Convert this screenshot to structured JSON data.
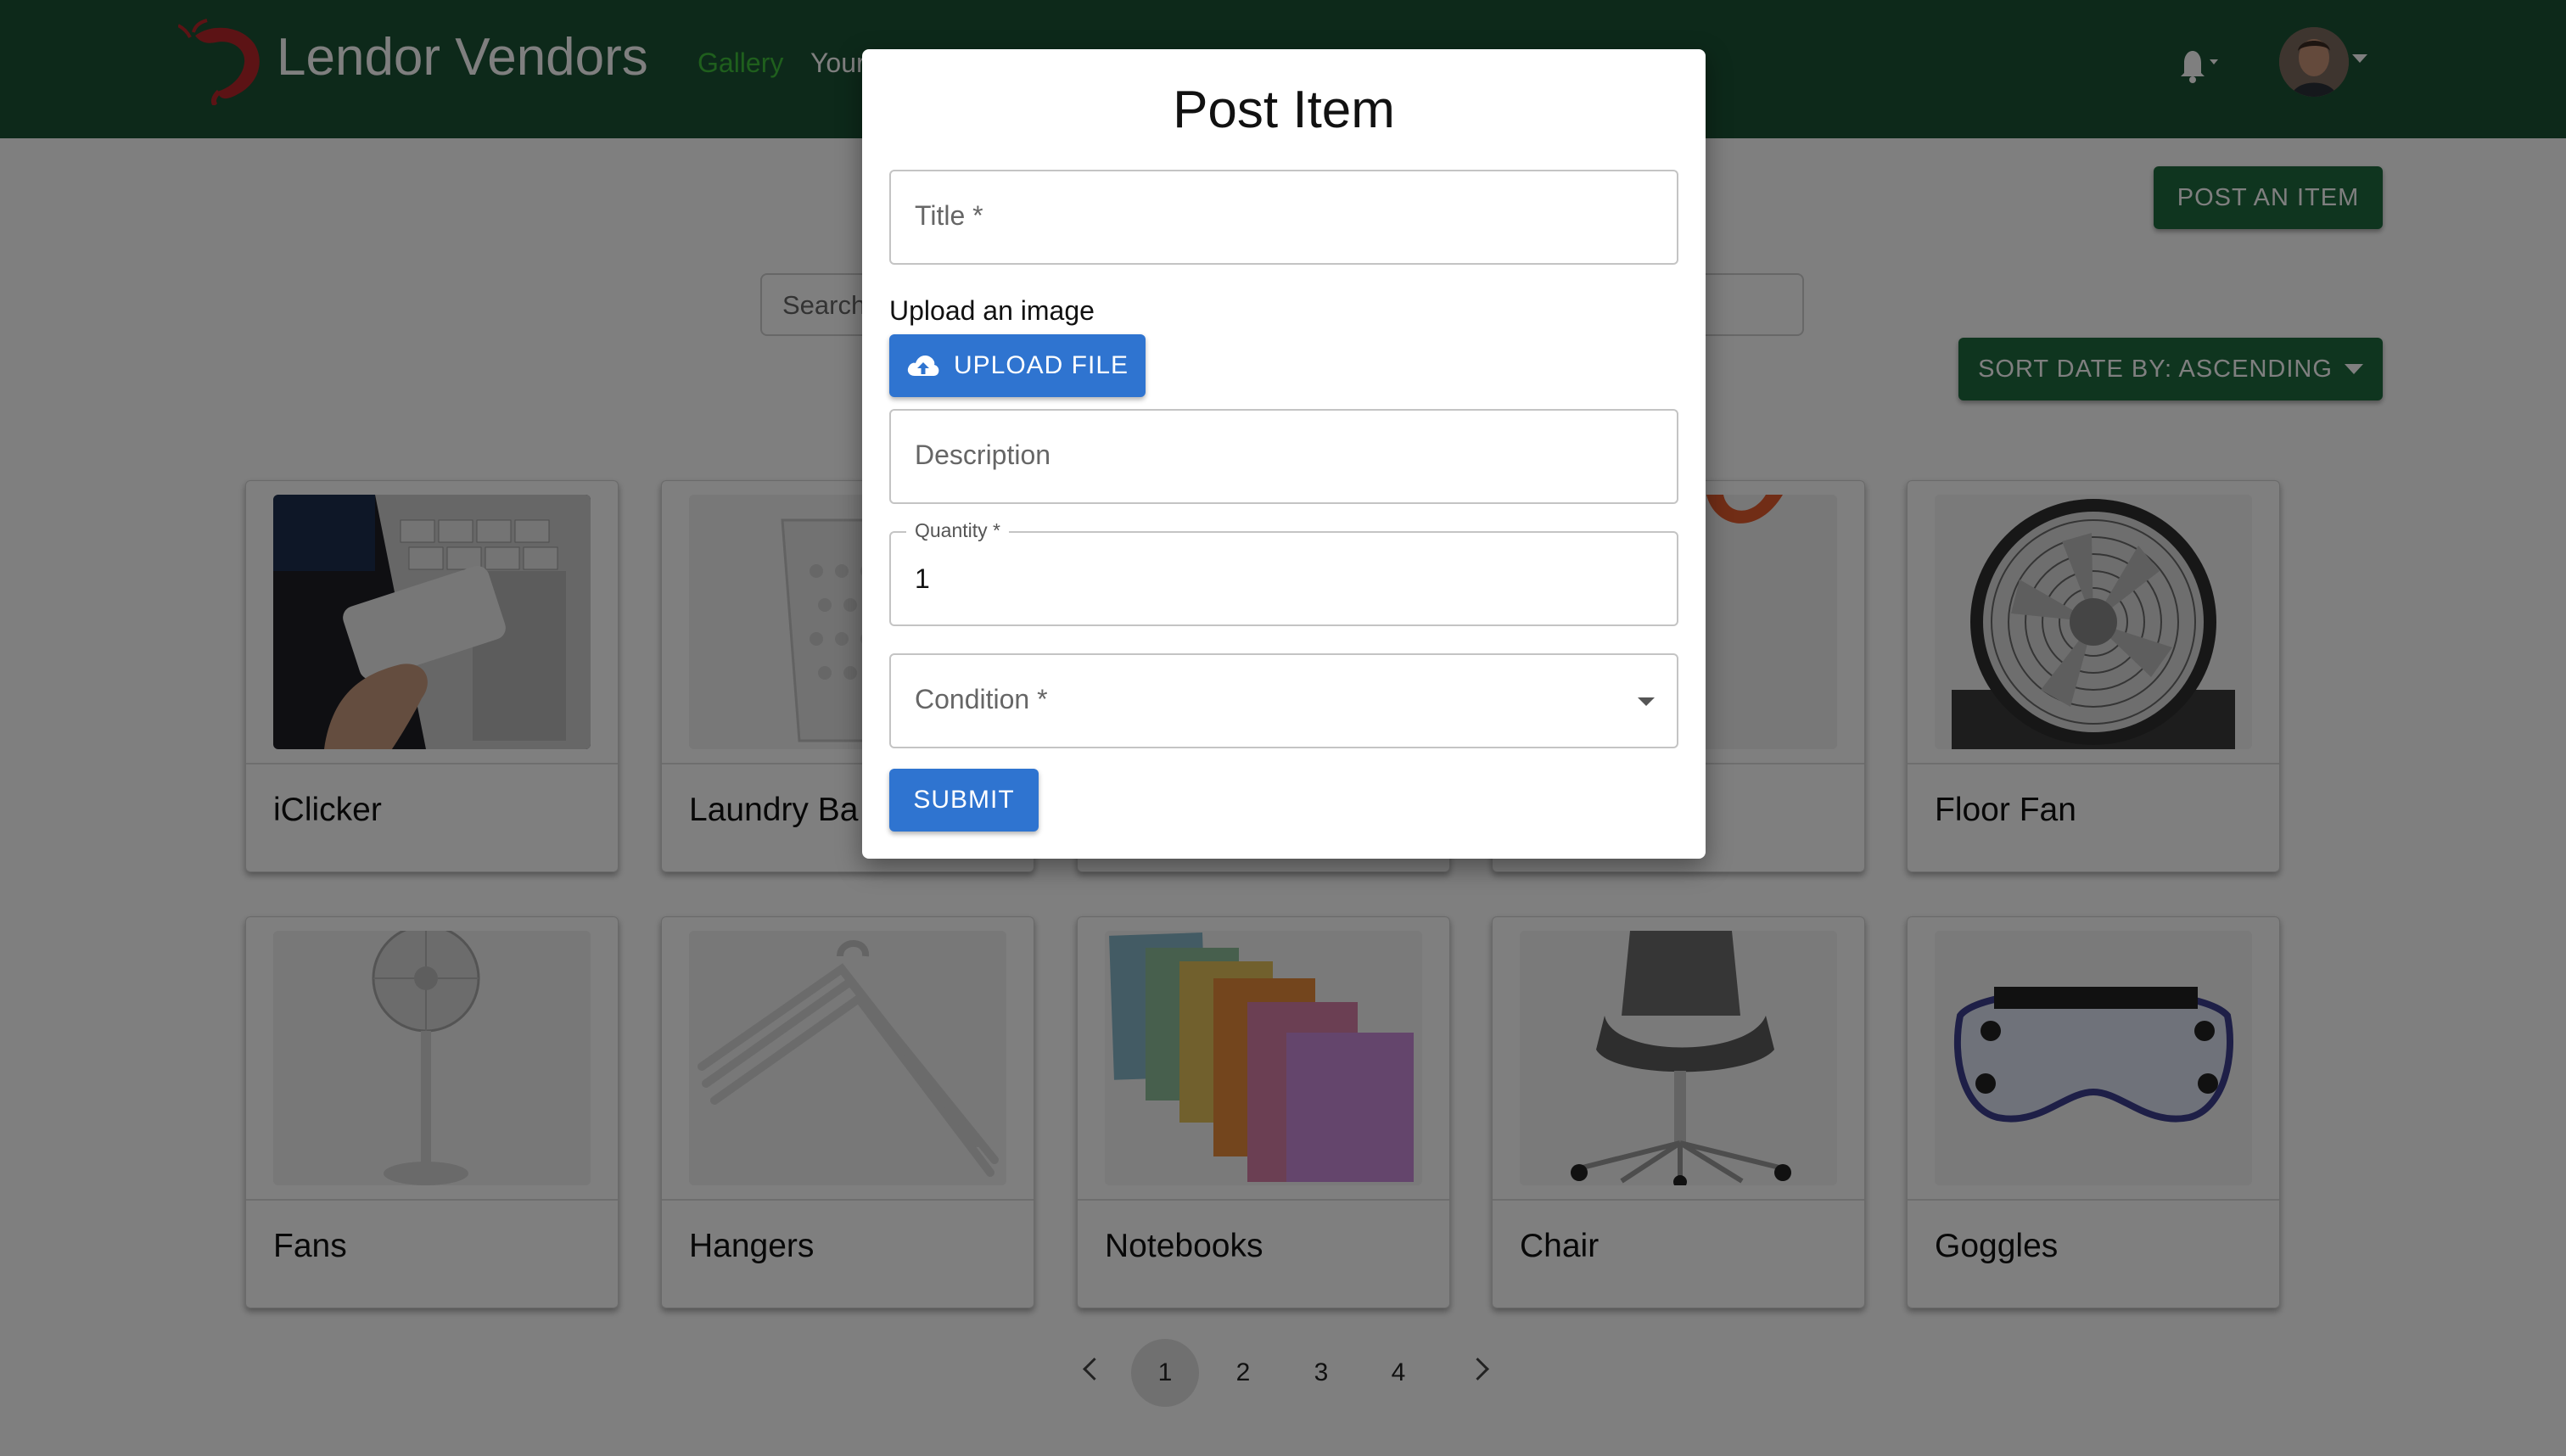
{
  "navbar": {
    "brand": "Lendor Vendors",
    "links": [
      "Gallery",
      "Your"
    ],
    "bell_icon": "bell-icon",
    "avatar_icon": "user-avatar"
  },
  "toolbar": {
    "post_item_label": "POST AN ITEM",
    "search_placeholder": "Search",
    "sort_label": "SORT DATE BY: ASCENDING"
  },
  "items": [
    {
      "title": "iClicker"
    },
    {
      "title": "Laundry Ba"
    },
    {
      "title": ""
    },
    {
      "title": ""
    },
    {
      "title": "Floor Fan"
    },
    {
      "title": "Fans"
    },
    {
      "title": "Hangers"
    },
    {
      "title": "Notebooks"
    },
    {
      "title": "Chair"
    },
    {
      "title": "Goggles"
    }
  ],
  "pagination": {
    "pages": [
      "1",
      "2",
      "3",
      "4"
    ],
    "current": "1"
  },
  "modal": {
    "title": "Post Item",
    "title_field_label": "Title *",
    "upload_label": "Upload an image",
    "upload_button": "UPLOAD FILE",
    "description_label": "Description",
    "quantity_label": "Quantity *",
    "quantity_value": "1",
    "condition_label": "Condition *",
    "submit_button": "SUBMIT"
  },
  "colors": {
    "navbar": "#1b5234",
    "green_button": "#1f6b3f",
    "blue_button": "#2f74d0",
    "active_nav": "#3fbf3a"
  }
}
